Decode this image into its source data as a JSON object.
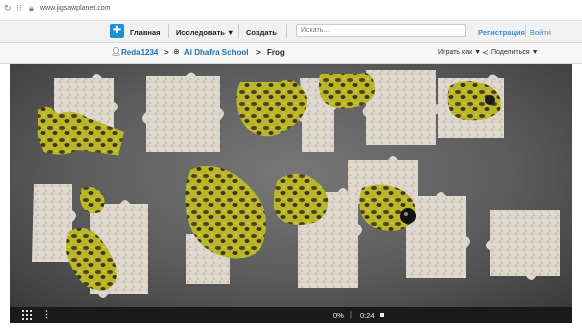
{
  "browser": {
    "url": "www.jigsawplanet.com",
    "back_icon": "reload-icon",
    "apps_icon": "apps-icon",
    "lock_icon": "lock-icon"
  },
  "nav": {
    "home": "Главная",
    "explore": "Исследовать ▼",
    "create": "Создать",
    "search_placeholder": "Искать...",
    "register": "Регистрация",
    "login": "Войти"
  },
  "breadcrumb": {
    "user": "Reda1234",
    "sep1": ">",
    "school": "Al Dhafra School",
    "sep2": ">",
    "puzzle": "Frog",
    "play_as": "Играть как ▼",
    "share": "Поделиться ▼"
  },
  "controls": {
    "progress": "0%",
    "divider": "|",
    "time": "0:24"
  },
  "colors": {
    "accent": "#3a8fd6",
    "link": "#1f6fb0",
    "logo": "#1d8fd8",
    "board": "#5a5a5a",
    "frog_green": "#b5b828",
    "frog_brown": "#5a3a1e"
  }
}
